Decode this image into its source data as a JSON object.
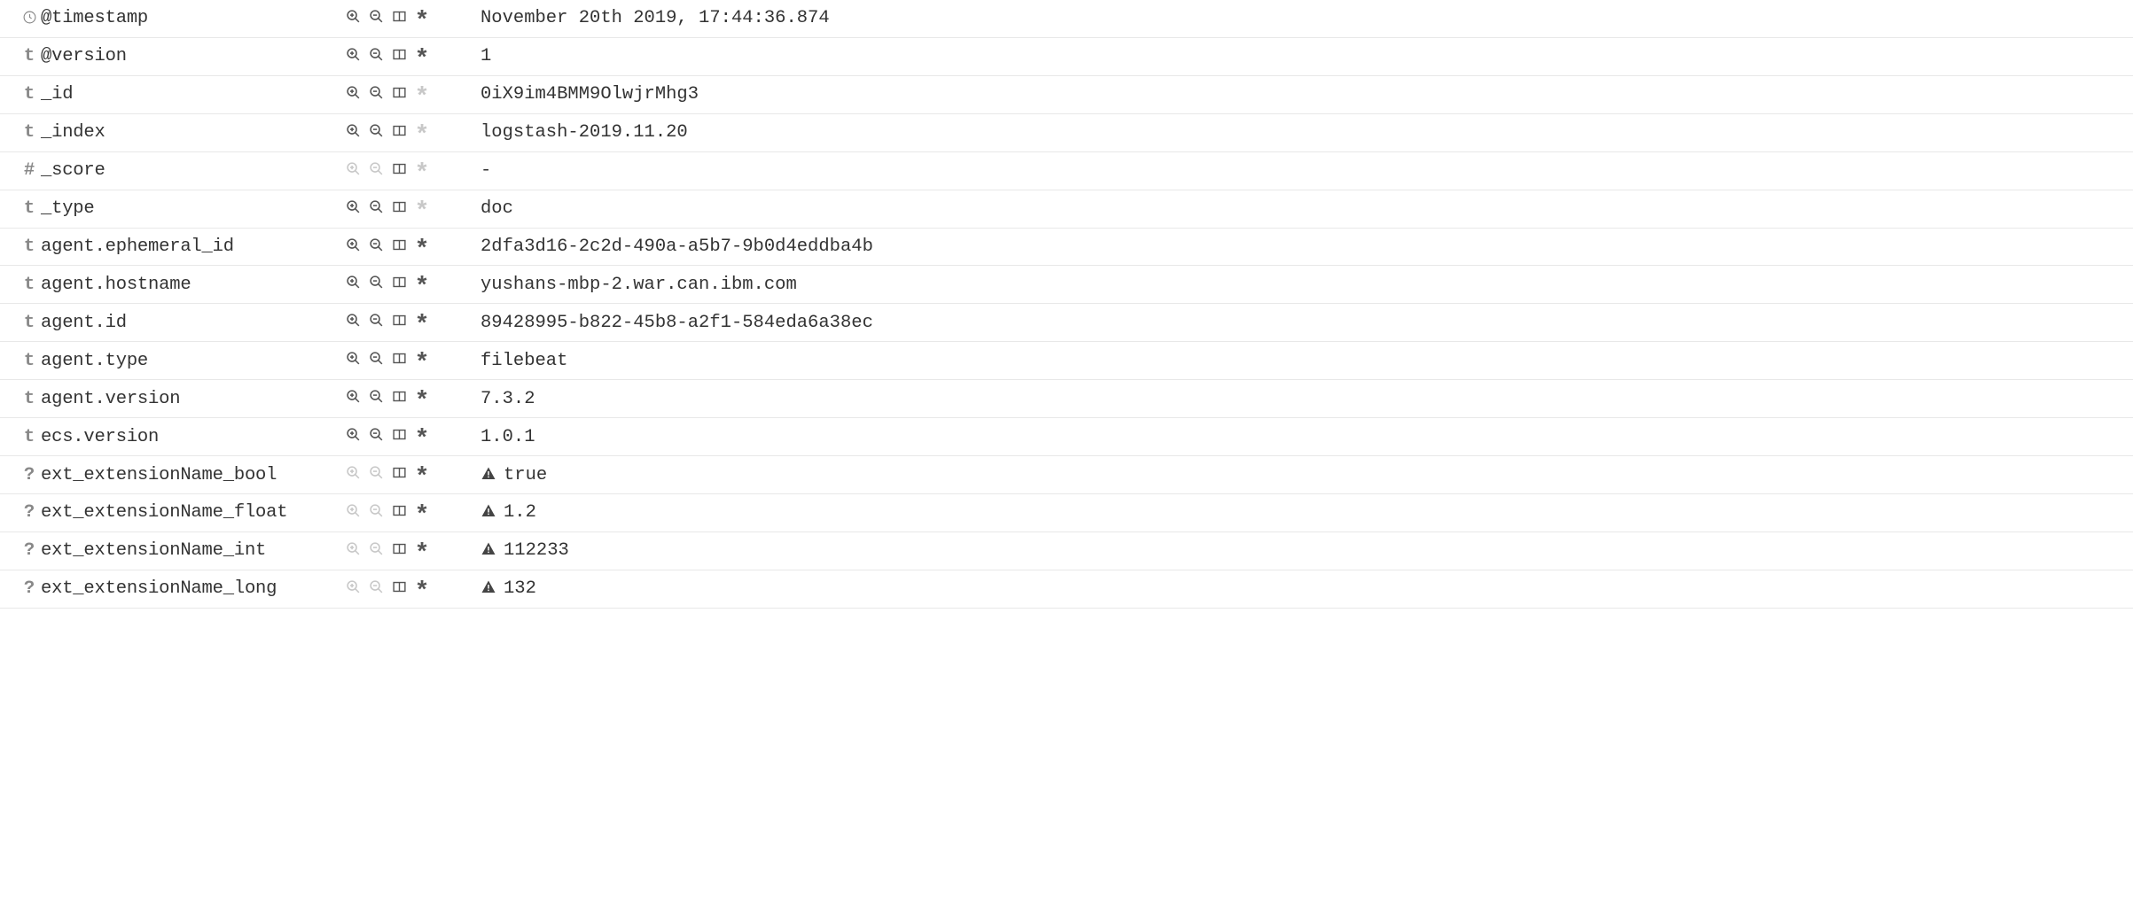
{
  "fields": [
    {
      "type": "clock",
      "name": "@timestamp",
      "value": "November 20th 2019, 17:44:36.874",
      "filterEnabled": true,
      "columnEnabled": true,
      "asteriskEnabled": true,
      "warning": false
    },
    {
      "type": "t",
      "name": "@version",
      "value": "1",
      "filterEnabled": true,
      "columnEnabled": true,
      "asteriskEnabled": true,
      "warning": false
    },
    {
      "type": "t",
      "name": "_id",
      "value": "0iX9im4BMM9OlwjrMhg3",
      "filterEnabled": true,
      "columnEnabled": true,
      "asteriskEnabled": false,
      "warning": false
    },
    {
      "type": "t",
      "name": "_index",
      "value": "logstash-2019.11.20",
      "filterEnabled": true,
      "columnEnabled": true,
      "asteriskEnabled": false,
      "warning": false
    },
    {
      "type": "#",
      "name": "_score",
      "value": " -",
      "filterEnabled": false,
      "columnEnabled": true,
      "asteriskEnabled": false,
      "warning": false
    },
    {
      "type": "t",
      "name": "_type",
      "value": "doc",
      "filterEnabled": true,
      "columnEnabled": true,
      "asteriskEnabled": false,
      "warning": false
    },
    {
      "type": "t",
      "name": "agent.ephemeral_id",
      "value": "2dfa3d16-2c2d-490a-a5b7-9b0d4eddba4b",
      "filterEnabled": true,
      "columnEnabled": true,
      "asteriskEnabled": true,
      "warning": false
    },
    {
      "type": "t",
      "name": "agent.hostname",
      "value": "yushans-mbp-2.war.can.ibm.com",
      "filterEnabled": true,
      "columnEnabled": true,
      "asteriskEnabled": true,
      "warning": false
    },
    {
      "type": "t",
      "name": "agent.id",
      "value": "89428995-b822-45b8-a2f1-584eda6a38ec",
      "filterEnabled": true,
      "columnEnabled": true,
      "asteriskEnabled": true,
      "warning": false
    },
    {
      "type": "t",
      "name": "agent.type",
      "value": "filebeat",
      "filterEnabled": true,
      "columnEnabled": true,
      "asteriskEnabled": true,
      "warning": false
    },
    {
      "type": "t",
      "name": "agent.version",
      "value": "7.3.2",
      "filterEnabled": true,
      "columnEnabled": true,
      "asteriskEnabled": true,
      "warning": false
    },
    {
      "type": "t",
      "name": "ecs.version",
      "value": "1.0.1",
      "filterEnabled": true,
      "columnEnabled": true,
      "asteriskEnabled": true,
      "warning": false
    },
    {
      "type": "?",
      "name": "ext_extensionName_bool",
      "value": "true",
      "filterEnabled": false,
      "columnEnabled": true,
      "asteriskEnabled": true,
      "warning": true
    },
    {
      "type": "?",
      "name": "ext_extensionName_float",
      "value": "1.2",
      "filterEnabled": false,
      "columnEnabled": true,
      "asteriskEnabled": true,
      "warning": true
    },
    {
      "type": "?",
      "name": "ext_extensionName_int",
      "value": "112233",
      "filterEnabled": false,
      "columnEnabled": true,
      "asteriskEnabled": true,
      "warning": true
    },
    {
      "type": "?",
      "name": "ext_extensionName_long",
      "value": "132",
      "filterEnabled": false,
      "columnEnabled": true,
      "asteriskEnabled": true,
      "warning": true
    }
  ]
}
